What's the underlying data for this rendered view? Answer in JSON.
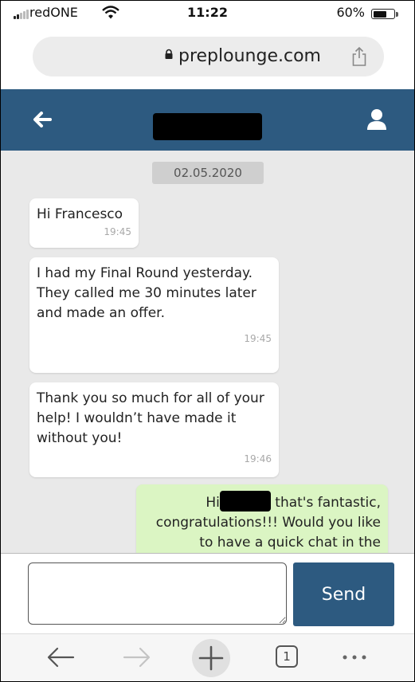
{
  "status_bar": {
    "carrier": "redONE",
    "time": "11:22",
    "battery": "60%",
    "battery_level": 0.6
  },
  "browser": {
    "domain": "preplounge.com"
  },
  "chat": {
    "date": "02.05.2020",
    "messages": [
      {
        "side": "received",
        "text": "Hi Francesco",
        "time": "19:45"
      },
      {
        "side": "received",
        "text": "I had my Final Round yesterday. They called me 30 minutes later and made an offer.",
        "time": "19:45"
      },
      {
        "side": "received",
        "text": "Thank you so much for all of your help! I wouldn’t have made it without you!",
        "time": "19:46"
      },
      {
        "side": "sent",
        "text_before": "Hi",
        "text_after": "that's fantastic, congratulations!!! Would you like to have a quick chat in the"
      }
    ]
  },
  "composer": {
    "placeholder": "",
    "send_label": "Send"
  },
  "toolbar": {
    "tab_count": "1"
  },
  "colors": {
    "header": "#2d5a80",
    "sent_bubble": "#dbf5c3",
    "chat_background": "#e9e9e9"
  }
}
